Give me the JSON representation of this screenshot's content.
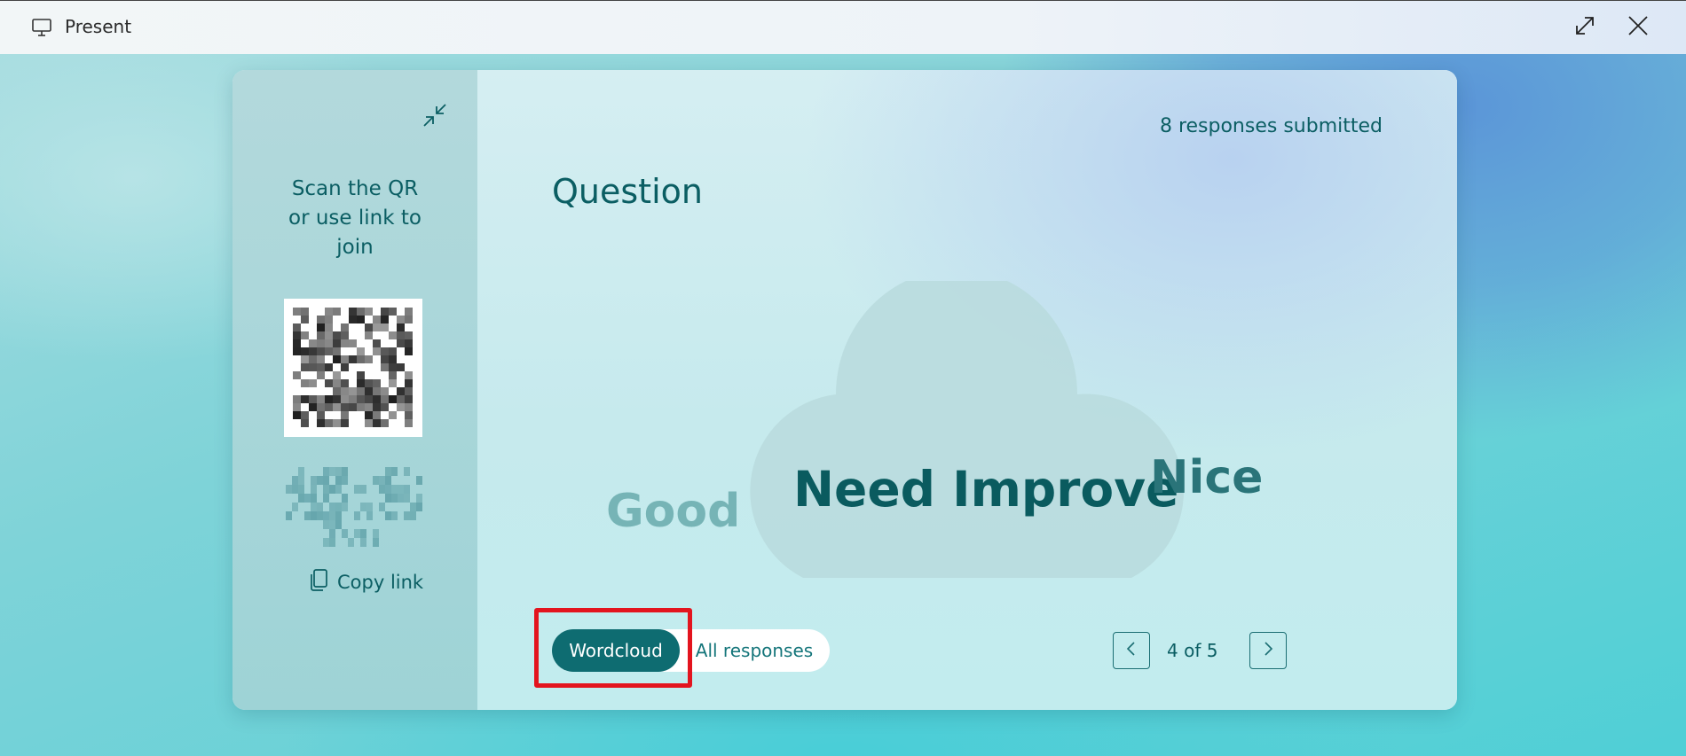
{
  "window": {
    "title": "Present",
    "icon": "presentation-monitor-icon",
    "expand_icon": "expand-diagonal-icon",
    "close_icon": "close-icon"
  },
  "sidebar": {
    "collapse_icon": "collapse-icon",
    "join_text_line1": "Scan the QR",
    "join_text_line2": "or use link to",
    "join_text_line3": "join",
    "copy_link_label": "Copy link",
    "copy_icon": "copy-icon"
  },
  "main": {
    "responses_count": "8 responses submitted",
    "question_title": "Question",
    "wordcloud": {
      "words": [
        "Good",
        "Need Improve",
        "Nice"
      ]
    },
    "view_toggle": {
      "active": "Wordcloud",
      "inactive": "All responses"
    },
    "pagination": {
      "label": "4 of 5",
      "prev_icon": "chevron-left-icon",
      "next_icon": "chevron-right-icon"
    }
  },
  "colors": {
    "accent": "#0e6c71",
    "text_teal": "#0b5e63",
    "highlight_box": "#e3141e"
  }
}
